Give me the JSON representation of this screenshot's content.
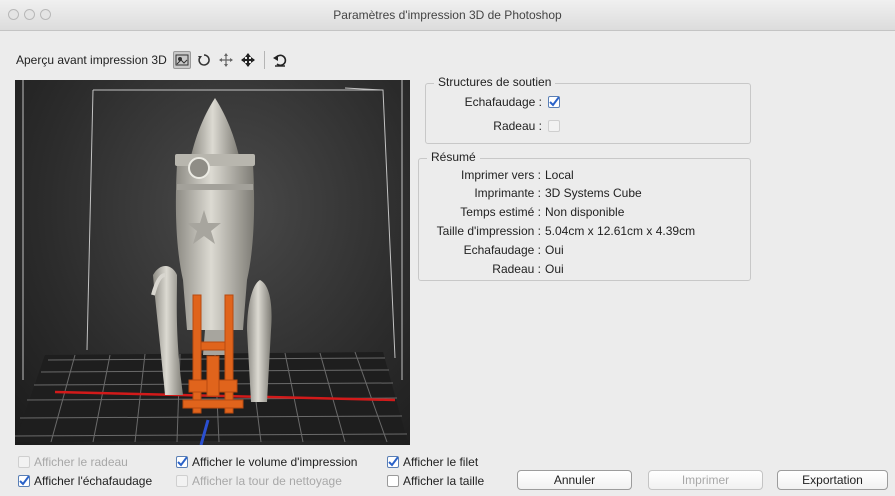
{
  "window": {
    "title": "Paramètres d'impression 3D de Photoshop"
  },
  "toolbar": {
    "label": "Aperçu avant impression 3D",
    "tools": [
      "scene-view-icon",
      "rotate-icon",
      "pan-icon",
      "move-icon",
      "reset-view-icon"
    ]
  },
  "support": {
    "title": "Structures de soutien",
    "scaffold_label": "Echafaudage :",
    "scaffold_checked": true,
    "raft_label": "Radeau :",
    "raft_checked": false
  },
  "summary": {
    "title": "Résumé",
    "rows": [
      {
        "label": "Imprimer vers :",
        "value": "Local"
      },
      {
        "label": "Imprimante :",
        "value": "3D Systems Cube"
      },
      {
        "label": "Temps estimé :",
        "value": "Non disponible"
      },
      {
        "label": "Taille d'impression :",
        "value": "5.04cm x 12.61cm x 4.39cm"
      },
      {
        "label": "Echafaudage :",
        "value": "Oui"
      },
      {
        "label": "Radeau :",
        "value": "Oui"
      }
    ]
  },
  "options": {
    "show_raft": {
      "label": "Afficher le radeau",
      "checked": false,
      "enabled": false
    },
    "show_scaffold": {
      "label": "Afficher l'échafaudage",
      "checked": true,
      "enabled": true
    },
    "show_volume": {
      "label": "Afficher le volume d'impression",
      "checked": true,
      "enabled": true
    },
    "show_cleaning_tower": {
      "label": "Afficher la tour de nettoyage",
      "checked": false,
      "enabled": false
    },
    "show_mesh": {
      "label": "Afficher le filet",
      "checked": true,
      "enabled": true
    },
    "show_size": {
      "label": "Afficher la taille",
      "checked": false,
      "enabled": true
    }
  },
  "buttons": {
    "cancel": "Annuler",
    "print": "Imprimer",
    "export": "Exportation"
  },
  "colors": {
    "check_blue": "#2a62c9",
    "scaffold_orange": "#e0641c",
    "grid_red": "#d21a1a"
  }
}
